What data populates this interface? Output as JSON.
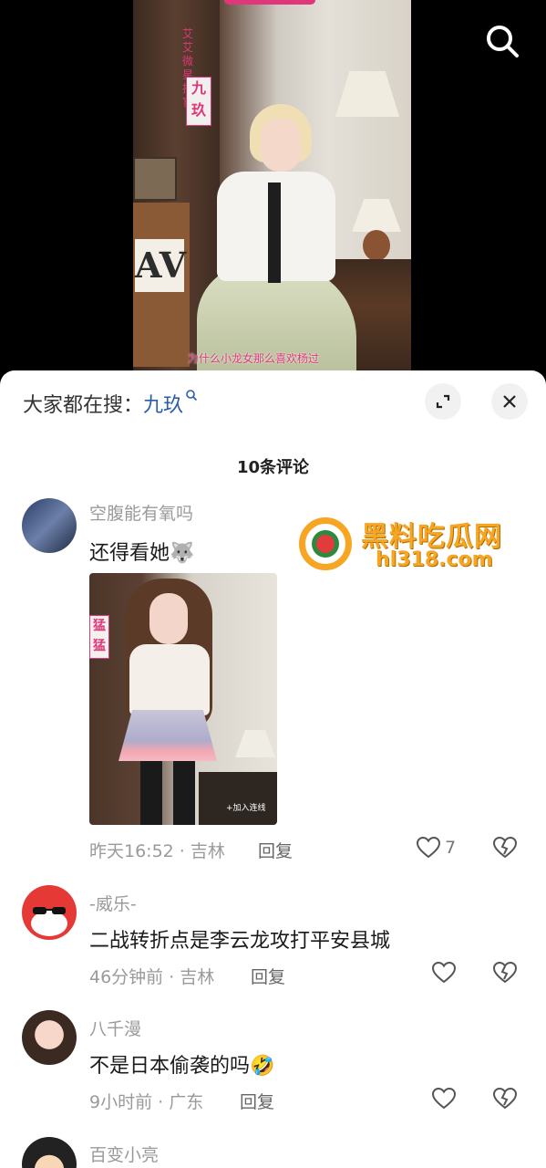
{
  "video": {
    "vertical_label": "艾艾微星推官",
    "name_tag": "九玖",
    "subtitle": "为什么小龙女那么喜欢杨过",
    "shelf_text": "AV",
    "search_icon": "search-icon"
  },
  "sheet": {
    "search_prefix": "大家都在搜：",
    "search_keyword": "九玖",
    "expand_icon": "expand-icon",
    "close_icon": "close-icon",
    "comment_count": "10条评论"
  },
  "watermark": {
    "title": "黑料吃瓜网",
    "url": "hl318.com"
  },
  "comments": [
    {
      "name": "空腹能有氧吗",
      "text": "还得看她🐺",
      "photo_tag": "猛猛",
      "photo_caption": "+加入连线",
      "time": "昨天16:52 · 吉林",
      "reply": "回复",
      "likes": "7"
    },
    {
      "name": "-威乐-",
      "text": "二战转折点是李云龙攻打平安县城",
      "time": "46分钟前 · 吉林",
      "reply": "回复",
      "likes": ""
    },
    {
      "name": "八千漫",
      "text": "不是日本偷袭的吗🤣",
      "time": "9小时前 · 广东",
      "reply": "回复",
      "likes": ""
    },
    {
      "name": "百变小亮"
    }
  ],
  "colors": {
    "accent_pink": "#e0367a",
    "keyword_blue": "#2b5ea8",
    "watermark_orange": "#f6a623"
  }
}
